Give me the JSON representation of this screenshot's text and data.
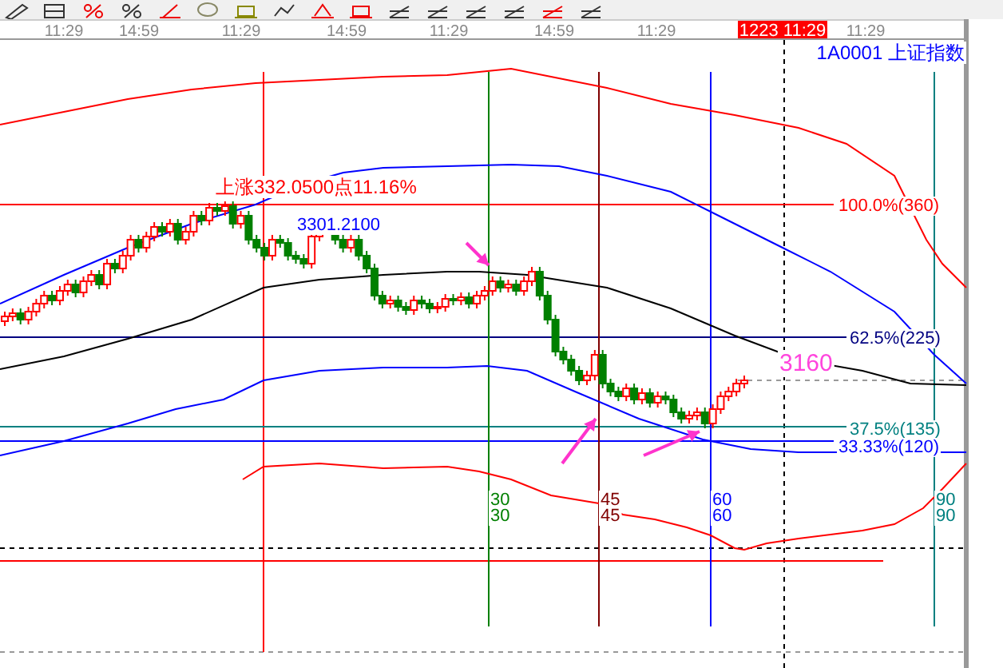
{
  "time_axis": {
    "labels": [
      {
        "text": "11:29",
        "selected": false
      },
      {
        "text": "14:59",
        "selected": false
      },
      {
        "text": "11:29",
        "selected": false
      },
      {
        "text": "14:59",
        "selected": false
      },
      {
        "text": "11:29",
        "selected": false
      },
      {
        "text": "14:59",
        "selected": false
      },
      {
        "text": "11:29",
        "selected": false
      },
      {
        "text": "1223 11:29",
        "selected": true
      },
      {
        "text": "11:29",
        "selected": false
      }
    ]
  },
  "chart": {
    "symbol": "1A0001",
    "name": "上证指数",
    "rise_label": "上涨332.0500点11.16%",
    "high_label": "3301.2100",
    "target_label": "3160",
    "levels": [
      {
        "label": "100.0%(360)",
        "color": "#ff0000"
      },
      {
        "label": "62.5%(225)",
        "color": "#000080"
      },
      {
        "label": "37.5%(135)",
        "color": "#008080"
      },
      {
        "label": "33.33%(120)",
        "color": "#0000ff"
      }
    ],
    "time_markers": [
      {
        "labels": [
          "30",
          "30"
        ],
        "color": "#008000"
      },
      {
        "labels": [
          "45",
          "45"
        ],
        "color": "#800000"
      },
      {
        "labels": [
          "60",
          "60"
        ],
        "color": "#0000ff"
      },
      {
        "labels": [
          "90",
          "90"
        ],
        "color": "#008080"
      }
    ]
  }
}
